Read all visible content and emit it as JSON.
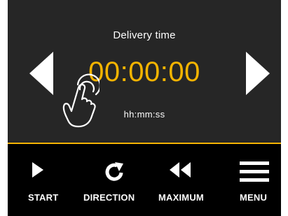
{
  "display": {
    "title": "Delivery time",
    "time": "00:00:00",
    "format": "hh:mm:ss"
  },
  "toolbar": {
    "start_label": "START",
    "direction_label": "DIRECTION",
    "maximum_label": "MAXIMUM",
    "menu_label": "MENU"
  },
  "icons": {
    "previous": "triangle-left-icon",
    "next": "triangle-right-icon",
    "touch": "tap-hand-icon",
    "start": "play-icon",
    "direction": "rotate-arrow-icon",
    "maximum": "rewind-icon",
    "menu": "hamburger-menu-icon"
  },
  "colors": {
    "accent": "#f5b400",
    "screen_background": "#262626",
    "toolbar_background": "#000000",
    "text": "#ffffff"
  }
}
